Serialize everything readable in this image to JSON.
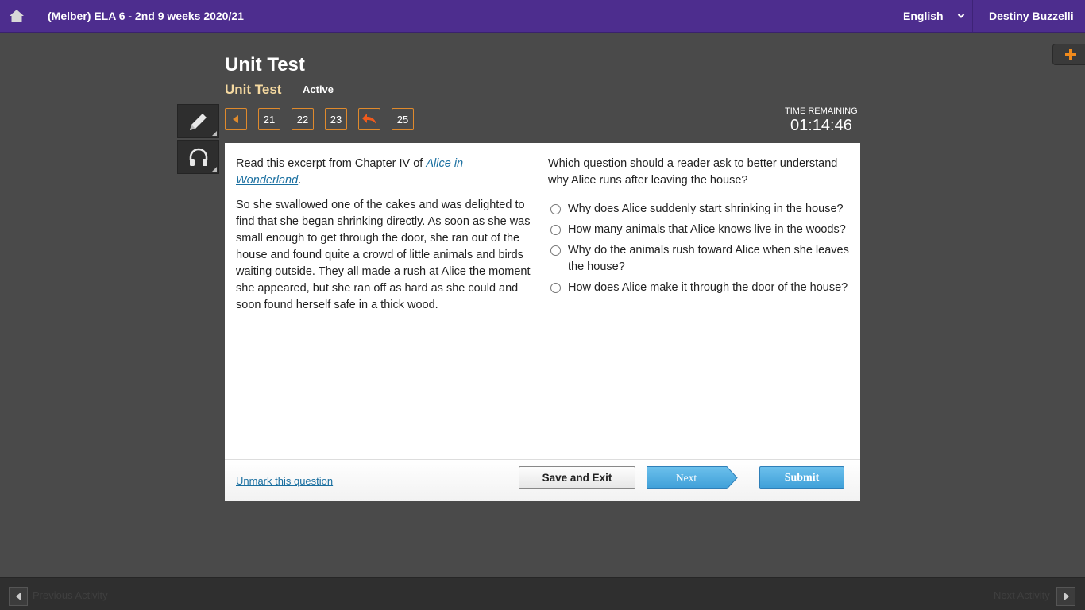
{
  "header": {
    "course_title": "(Melber) ELA 6 - 2nd 9 weeks 2020/21",
    "language": "English",
    "user_name": "Destiny Buzzelli"
  },
  "assessment": {
    "title": "Unit Test",
    "subtitle": "Unit Test",
    "status": "Active"
  },
  "question_nav": {
    "buttons": [
      "21",
      "22",
      "23",
      "25"
    ]
  },
  "timer": {
    "label": "TIME REMAINING",
    "value": "01:14:46"
  },
  "passage": {
    "intro_prefix": "Read this excerpt from Chapter IV of ",
    "intro_link": "Alice in Wonderland",
    "intro_suffix": ".",
    "body": "So she swallowed one of the cakes and was delighted to find that she began shrinking directly. As soon as she was small enough to get through the door, she ran out of the house and found quite a crowd of little animals and birds waiting outside. They all made a rush at Alice the moment she appeared, but she ran off as hard as she could and soon found herself safe in a thick wood."
  },
  "question": {
    "text": "Which question should a reader ask to better understand why Alice runs after leaving the house?",
    "options": [
      "Why does Alice suddenly start shrinking in the house?",
      "How many animals that Alice knows live in the woods?",
      "Why do the animals rush toward Alice when she leaves the house?",
      "How does Alice make it through the door of the house?"
    ]
  },
  "footer": {
    "unmark_label": "Unmark this question",
    "save_label": "Save and Exit",
    "next_label": "Next",
    "submit_label": "Submit"
  },
  "bottom_nav": {
    "previous_label": "Previous Activity",
    "next_label": "Next Activity"
  },
  "colors": {
    "header_bg": "#4d2d8e",
    "accent_orange": "#e08a2c",
    "button_blue": "#4aa8de"
  }
}
